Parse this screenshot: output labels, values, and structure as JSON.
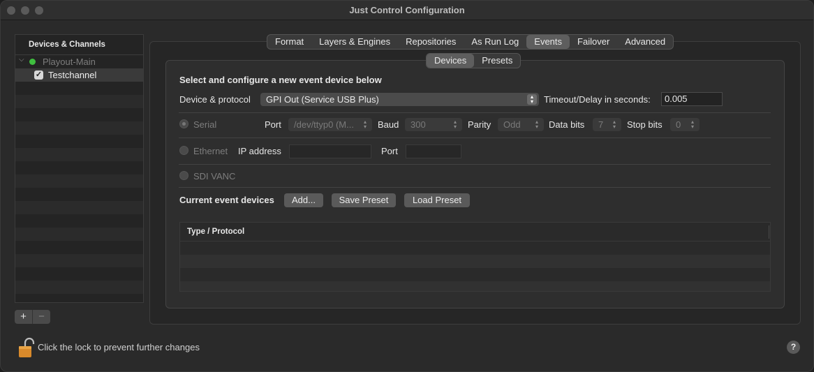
{
  "window": {
    "title": "Just Control Configuration"
  },
  "sidebar": {
    "header": "Devices & Channels",
    "device": {
      "label": "Playout-Main",
      "status_color": "#3fbf3f"
    },
    "channel": {
      "label": "Testchannel",
      "checked": true
    },
    "add_label": "+",
    "remove_label": "−"
  },
  "tabs": [
    "Format",
    "Layers & Engines",
    "Repositories",
    "As Run Log",
    "Events",
    "Failover",
    "Advanced"
  ],
  "active_tab": "Events",
  "subtabs": [
    "Devices",
    "Presets"
  ],
  "active_subtab": "Devices",
  "events": {
    "heading": "Select and configure a new event device below",
    "device_protocol_label": "Device & protocol",
    "device_protocol_value": "GPI Out (Service USB Plus)",
    "timeout_label": "Timeout/Delay in seconds:",
    "timeout_value": "0.005",
    "serial": {
      "label": "Serial",
      "port_label": "Port",
      "port_value": "/dev/ttyp0 (M...",
      "baud_label": "Baud",
      "baud_value": "300",
      "parity_label": "Parity",
      "parity_value": "Odd",
      "databits_label": "Data bits",
      "databits_value": "7",
      "stopbits_label": "Stop bits",
      "stopbits_value": "0"
    },
    "ethernet": {
      "label": "Ethernet",
      "ip_label": "IP address",
      "ip_value": "",
      "port_label": "Port",
      "port_value": ""
    },
    "sdi": {
      "label": "SDI VANC"
    },
    "current_label": "Current event devices",
    "add_button": "Add...",
    "save_preset_button": "Save Preset",
    "load_preset_button": "Load Preset",
    "table": {
      "columns": [
        "Type / Protocol"
      ],
      "rows": []
    }
  },
  "footer": {
    "lock_text": "Click the lock to prevent further changes",
    "help_label": "?"
  }
}
